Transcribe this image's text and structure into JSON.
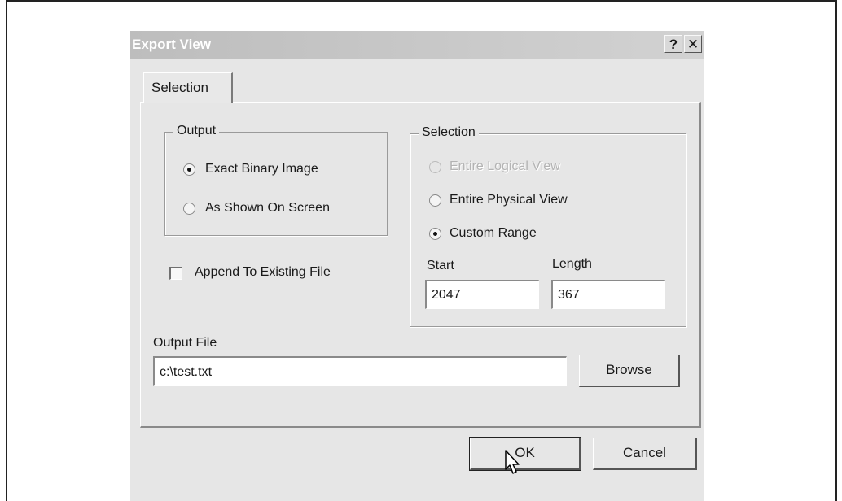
{
  "dialog": {
    "title": "Export View",
    "help_label": "?",
    "close_label": "✕",
    "tabs": [
      {
        "label": "Selection"
      }
    ]
  },
  "output_group": {
    "legend": "Output",
    "options": [
      {
        "label": "Exact Binary Image",
        "selected": true
      },
      {
        "label": "As Shown On Screen",
        "selected": false
      }
    ]
  },
  "selection_group": {
    "legend": "Selection",
    "options": [
      {
        "label": "Entire Logical View",
        "selected": false,
        "disabled": true
      },
      {
        "label": "Entire Physical View",
        "selected": false,
        "disabled": false
      },
      {
        "label": "Custom Range",
        "selected": true,
        "disabled": false
      }
    ],
    "start_label": "Start",
    "start_value": "2047",
    "length_label": "Length",
    "length_value": "367"
  },
  "append_checkbox": {
    "label": "Append To Existing File",
    "checked": false
  },
  "output_file": {
    "label": "Output File",
    "value": "c:\\test.txt",
    "browse_label": "Browse"
  },
  "footer": {
    "ok_label": "OK",
    "cancel_label": "Cancel"
  }
}
